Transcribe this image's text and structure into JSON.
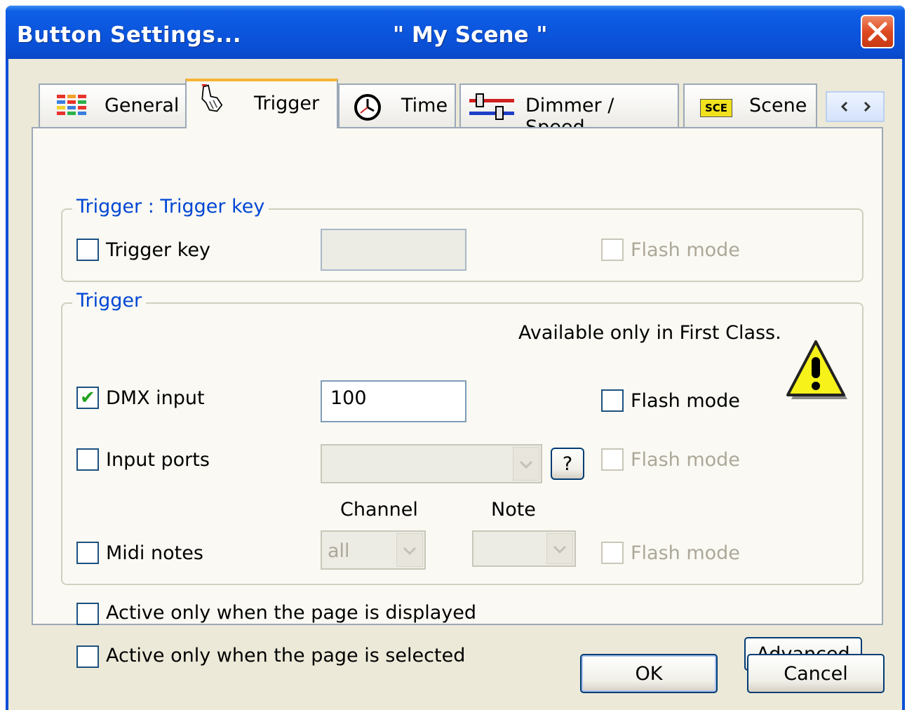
{
  "window": {
    "title": "Button  Settings...",
    "subtitle": "\" My Scene \""
  },
  "tabs": [
    {
      "label": "General",
      "icon": "color-grid-icon"
    },
    {
      "label": "Trigger",
      "icon": "hand-pointer-icon",
      "active": true
    },
    {
      "label": "Time",
      "icon": "clock-icon"
    },
    {
      "label": "Dimmer / Speed",
      "icon": "sliders-icon"
    },
    {
      "label": "Scene",
      "icon": "sce-icon",
      "icon_text": "SCE"
    }
  ],
  "group1": {
    "legend": "Trigger : Trigger key",
    "trigger_key": {
      "label": "Trigger key",
      "checked": false
    },
    "flash_mode": "Flash mode"
  },
  "group2": {
    "legend": "Trigger",
    "notice": "Available only in First Class.",
    "dmx": {
      "label": "DMX input",
      "checked": true,
      "value": "100",
      "flash_mode": "Flash mode"
    },
    "input_ports": {
      "label": "Input ports",
      "help": "?",
      "flash_mode": "Flash mode"
    },
    "channel_label": "Channel",
    "note_label": "Note",
    "midi": {
      "label": "Midi notes",
      "channel_value": "all",
      "flash_mode": "Flash mode"
    }
  },
  "options": {
    "page_displayed": "Active only when the page is displayed",
    "page_selected": "Active only when the page is selected"
  },
  "buttons": {
    "advanced": "Advanced",
    "ok": "OK",
    "cancel": "Cancel"
  },
  "colors": {
    "titlebar": "#0b54dc",
    "legend": "#0046d5",
    "face": "#ece9d8",
    "active_tab": "#f7b436"
  }
}
